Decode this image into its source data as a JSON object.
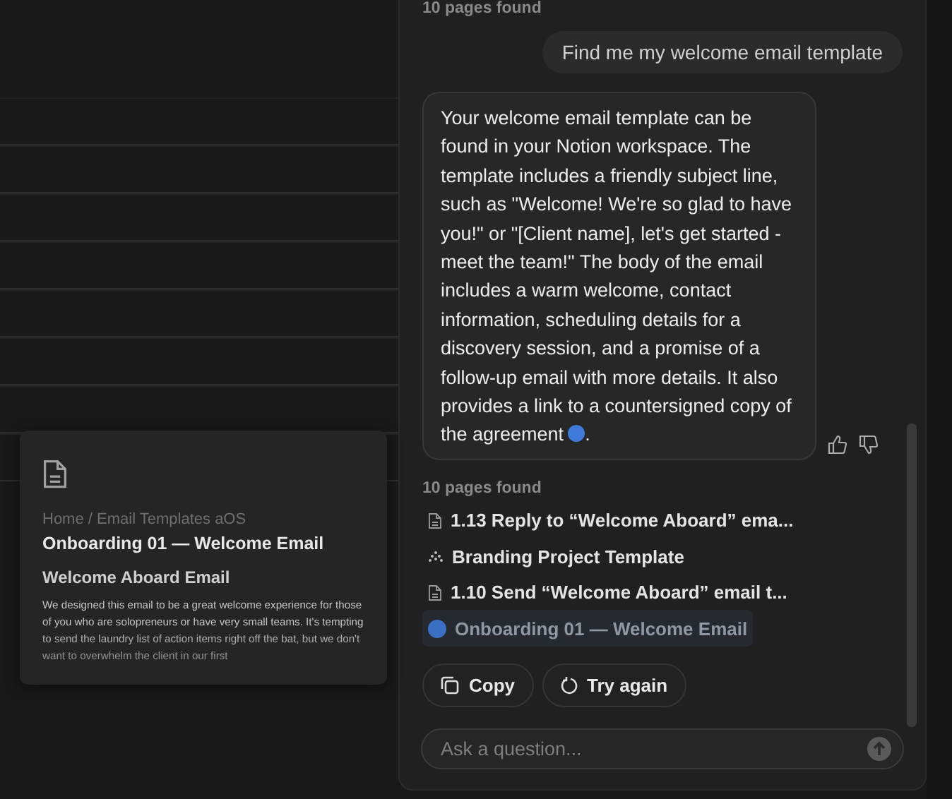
{
  "top_status": "10 pages found",
  "user_message": "Find me my welcome email template",
  "answer": {
    "text": "Your welcome email template can be found in your Notion workspace. The template includes a friendly subject line, such as \"Welcome! We're so glad to have you!\" or \"[Client name], let's get started - meet the team!\" The body of the email includes a warm welcome, contact information, scheduling details for a discovery session, and a promise of a follow-up email with more details. It also provides a link to a countersigned copy of the agreement",
    "after_citation": "."
  },
  "sources": {
    "summary": "10 pages found",
    "items": [
      {
        "kind": "page",
        "title": "1.13 Reply to “Welcome Aboard” ema...",
        "selected": false
      },
      {
        "kind": "emblem",
        "title": "Branding Project Template",
        "selected": false
      },
      {
        "kind": "page",
        "title": "1.10 Send “Welcome Aboard” email t...",
        "selected": false
      },
      {
        "kind": "avatar",
        "title": "Onboarding 01 — Welcome Email",
        "selected": true
      }
    ]
  },
  "actions": [
    {
      "kind": "copy",
      "label": "Copy"
    },
    {
      "kind": "retry",
      "label": "Try again"
    }
  ],
  "input": {
    "placeholder": "Ask a question..."
  },
  "preview": {
    "breadcrumb": "Home / Email Templates aOS",
    "title": "Onboarding 01 — Welcome Email",
    "heading": "Welcome Aboard Email",
    "body": "We designed this email to be a great welcome experience for those of you who are solopreneurs or have very small teams. It's tempting to send the laundry list of action items right off the bat, but we don't want to overwhelm the client in our first"
  }
}
